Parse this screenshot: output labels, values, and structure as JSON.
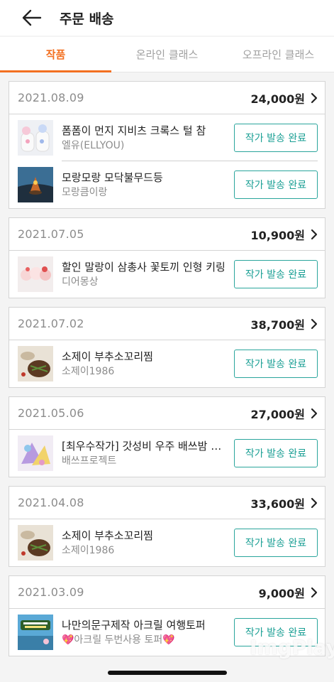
{
  "header": {
    "title": "주문 배송",
    "back_icon": "arrow-left-icon"
  },
  "tabs": [
    {
      "label": "작품",
      "active": true
    },
    {
      "label": "온라인 클래스",
      "active": false
    },
    {
      "label": "오프라인 클래스",
      "active": false
    }
  ],
  "colors": {
    "accent": "#f37021",
    "button": "#1a9f94",
    "muted": "#8c8c8c"
  },
  "orders": [
    {
      "date": "2021.08.09",
      "price": "24,000원",
      "items": [
        {
          "name": "폼폼이 먼지 지비츠 크록스 털 참",
          "seller": "엘유(ELLYOU)",
          "button": "작가 발송 완료"
        },
        {
          "name": "모랑모랑 모닥불무드등",
          "seller": "모랑큼이랑",
          "button": "작가 발송 완료"
        }
      ]
    },
    {
      "date": "2021.07.05",
      "price": "10,900원",
      "items": [
        {
          "name": "할인 말랑이 삼총사 꽃토끼 인형 키링",
          "seller": "디어몽상",
          "button": "작가 발송 완료"
        }
      ]
    },
    {
      "date": "2021.07.02",
      "price": "38,700원",
      "items": [
        {
          "name": "소제이 부추소꼬리찜",
          "seller": "소제이1986",
          "button": "작가 발송 완료"
        }
      ]
    },
    {
      "date": "2021.05.06",
      "price": "27,000원",
      "items": [
        {
          "name": "[최우수작가] 갓성비 우주 배쓰밤 세트",
          "seller": "배쓰프로젝트",
          "button": "작가 발송 완료"
        }
      ]
    },
    {
      "date": "2021.04.08",
      "price": "33,600원",
      "items": [
        {
          "name": "소제이 부추소꼬리찜",
          "seller": "소제이1986",
          "button": "작가 발송 완료"
        }
      ]
    },
    {
      "date": "2021.03.09",
      "price": "9,000원",
      "items": [
        {
          "name": "나만의문구제작 아크릴 여행토퍼",
          "seller": "💖아크릴 두번사용 토퍼💖",
          "button": "작가 발송 완료"
        }
      ]
    }
  ],
  "watermark": "ImgPlay"
}
